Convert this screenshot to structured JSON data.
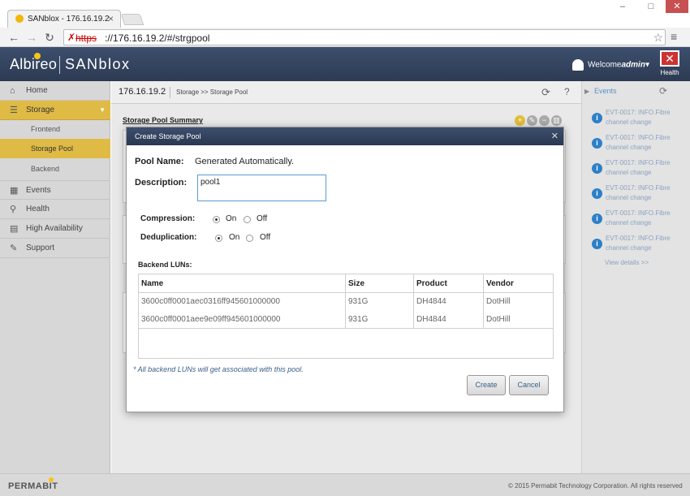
{
  "browser": {
    "tab_title": "SANblox - 176.16.19.2",
    "url_scheme": "https",
    "url_rest": "://176.16.19.2/#/strgpool"
  },
  "header": {
    "logo_company": "Albireo",
    "logo_product": "SANblox",
    "welcome_prefix": "Welcome",
    "welcome_user": "admin",
    "health_label": "Health"
  },
  "sidebar": {
    "items": [
      {
        "label": "Home",
        "icon": "home-icon"
      },
      {
        "label": "Storage",
        "icon": "menu-icon"
      },
      {
        "label": "Events",
        "icon": "calendar-icon"
      },
      {
        "label": "Health",
        "icon": "magnifier-icon"
      },
      {
        "label": "High Availability",
        "icon": "servers-icon"
      },
      {
        "label": "Support",
        "icon": "wrench-icon"
      }
    ],
    "storage_subitems": [
      "Frontend",
      "Storage Pool",
      "Backend"
    ]
  },
  "breadcrumb": {
    "ip": "176.16.19.2",
    "path": "Storage >> Storage Pool"
  },
  "summary": {
    "title": "Storage Pool Summary"
  },
  "events": {
    "title": "Events",
    "items": [
      "EVT-0017: INFO.Fibre channel change",
      "EVT-0017: INFO.Fibre channel change",
      "EVT-0017: INFO.Fibre channel change",
      "EVT-0017: INFO.Fibre channel change",
      "EVT-0017: INFO.Fibre channel change",
      "EVT-0017: INFO.Fibre channel change"
    ],
    "view_details": "View details >>"
  },
  "footer": {
    "logo": "PERMABIT",
    "copyright": "© 2015 Permabit Technology Corporation. All rights reserved"
  },
  "modal": {
    "title": "Create Storage Pool",
    "pool_name_label": "Pool Name:",
    "pool_name_value": "Generated Automatically.",
    "description_label": "Description:",
    "description_value": "pool1",
    "compression_label": "Compression:",
    "dedup_label": "Deduplication:",
    "on_label": "On",
    "off_label": "Off",
    "compression_on": true,
    "dedup_on": true,
    "luns_label": "Backend LUNs:",
    "columns": [
      "Name",
      "Size",
      "Product",
      "Vendor"
    ],
    "rows": [
      [
        "3600c0ff0001aec0316ff945601000000",
        "931G",
        "DH4844",
        "DotHill"
      ],
      [
        "3600c0ff0001aee9e09ff945601000000",
        "931G",
        "DH4844",
        "DotHill"
      ]
    ],
    "note": "* All backend LUNs will get associated with this pool.",
    "create_label": "Create",
    "cancel_label": "Cancel"
  }
}
